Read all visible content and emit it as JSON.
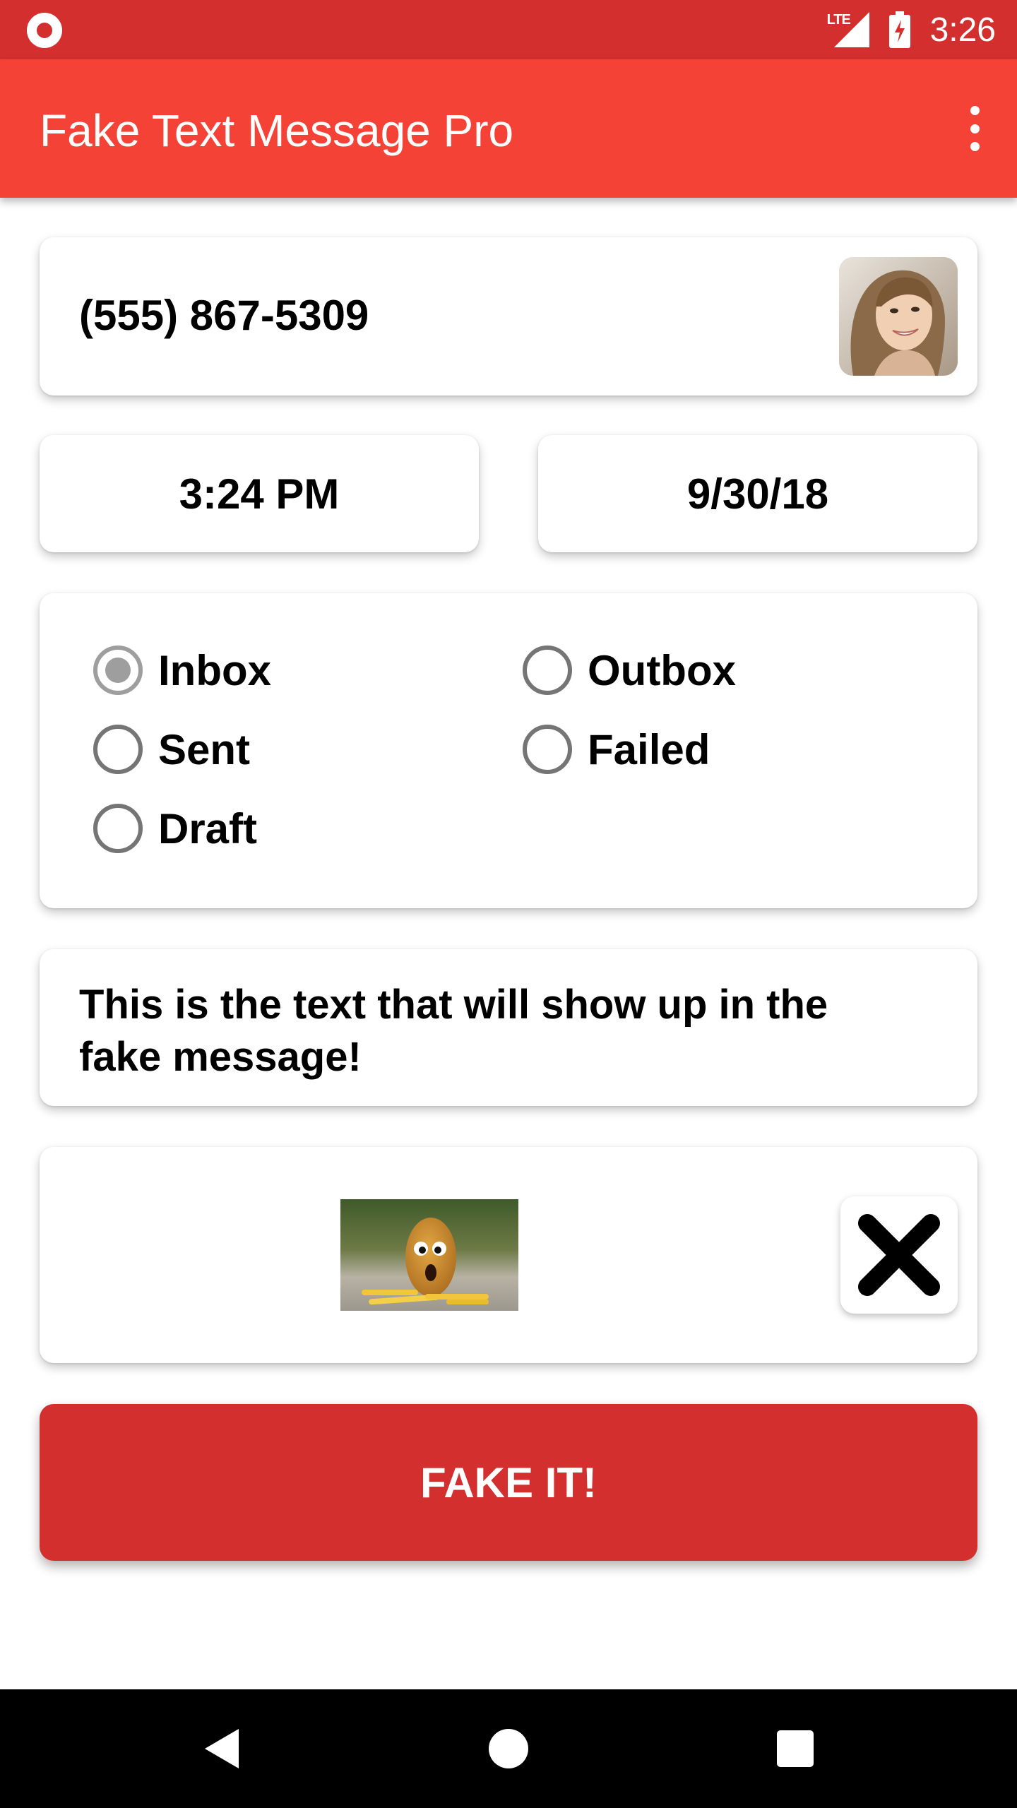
{
  "status_bar": {
    "time": "3:26",
    "network_label": "LTE",
    "icons": [
      "screen-record-icon",
      "signal-icon",
      "battery-charging-icon"
    ]
  },
  "app_bar": {
    "title": "Fake Text Message Pro",
    "menu_icon": "overflow-menu-icon"
  },
  "contact": {
    "phone": "(555) 867-5309",
    "avatar_icon": "contact-avatar-photo"
  },
  "datetime": {
    "time": "3:24 PM",
    "date": "9/30/18"
  },
  "message_type": {
    "selected": "Inbox",
    "options": [
      "Inbox",
      "Outbox",
      "Sent",
      "Failed",
      "Draft"
    ]
  },
  "message": {
    "text": "This is the text that will show up in the fake message!"
  },
  "attachment": {
    "image_icon": "attached-image-thumbnail",
    "remove_icon": "close-icon"
  },
  "actions": {
    "fake_label": "FAKE IT!"
  },
  "nav_bar": {
    "icons": [
      "back-icon",
      "home-icon",
      "recents-icon"
    ]
  },
  "colors": {
    "status_bar": "#d32f2f",
    "app_bar": "#f44336",
    "primary_button": "#d32f2f",
    "radio_checked": "#9e9e9e"
  }
}
